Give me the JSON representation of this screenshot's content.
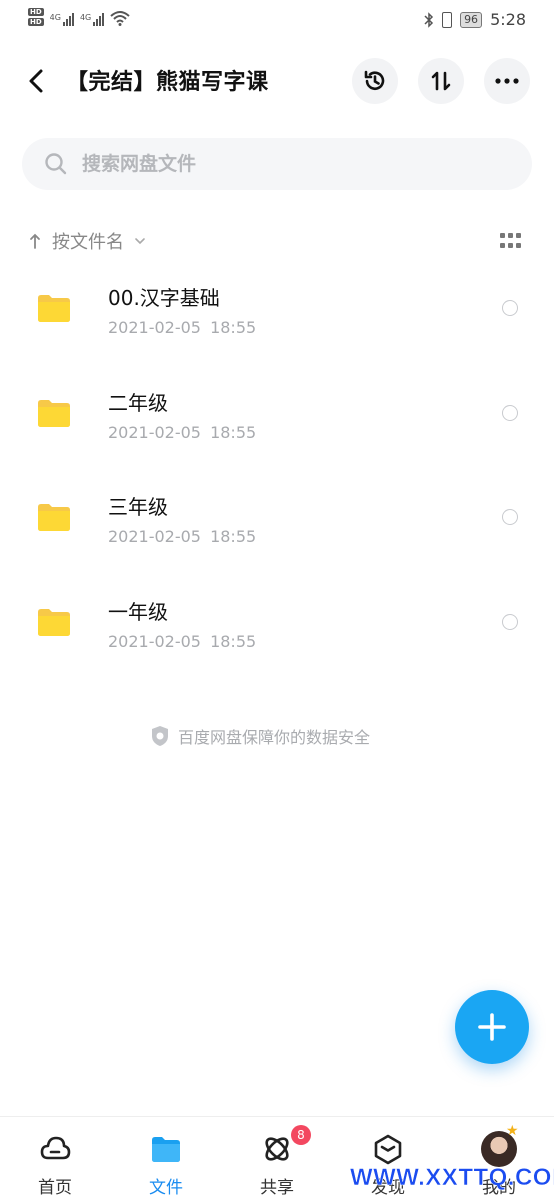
{
  "status_bar": {
    "time": "5:28",
    "battery": "96",
    "network_left": "4G",
    "network_right": "4G",
    "hd1": "HD",
    "hd2": "HD"
  },
  "header": {
    "title": "【完结】熊猫写字课",
    "icons": [
      "back-icon",
      "history-icon",
      "sort-transfer-icon",
      "more-icon"
    ]
  },
  "search": {
    "placeholder": "搜索网盘文件",
    "value": ""
  },
  "sort": {
    "label": "按文件名",
    "direction_icon": "arrow-up-icon"
  },
  "files": [
    {
      "name": "00.汉字基础",
      "date": "2021-02-05 18:55",
      "type": "folder"
    },
    {
      "name": "二年级",
      "date": "2021-02-05 18:55",
      "type": "folder"
    },
    {
      "name": "三年级",
      "date": "2021-02-05 18:55",
      "type": "folder"
    },
    {
      "name": "一年级",
      "date": "2021-02-05 18:55",
      "type": "folder"
    }
  ],
  "footer_note": "百度网盘保障你的数据安全",
  "bottom_nav": [
    {
      "label": "首页",
      "icon": "cloud-home-icon",
      "active": false
    },
    {
      "label": "文件",
      "icon": "folder-icon",
      "active": true
    },
    {
      "label": "共享",
      "icon": "share-atom-icon",
      "active": false,
      "badge": "8"
    },
    {
      "label": "发现",
      "icon": "discover-box-icon",
      "active": false
    },
    {
      "label": "我的",
      "icon": "avatar",
      "active": false
    }
  ],
  "watermark": "WWW.XXTTQ.COM",
  "colors": {
    "accent": "#1a8cf0",
    "fab": "#1aa6f3",
    "folder": "#fdd835",
    "badge": "#f34860"
  }
}
